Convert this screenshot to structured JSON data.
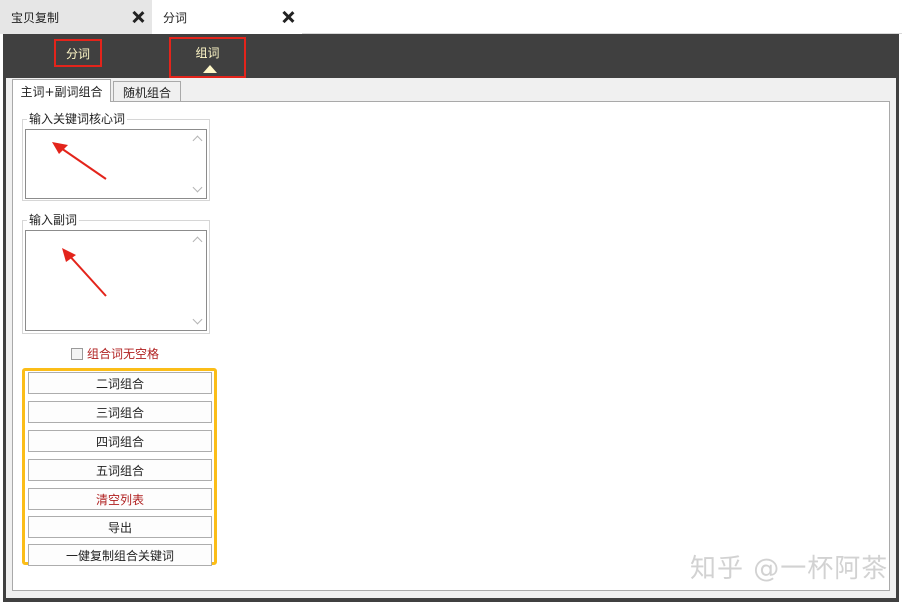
{
  "doc_tabs": [
    {
      "label": "宝贝复制"
    },
    {
      "label": "分词"
    }
  ],
  "modes": {
    "fenci": "分词",
    "zuci": "组词"
  },
  "inner_tabs": [
    {
      "label": "主词+副词组合"
    },
    {
      "label": "随机组合"
    }
  ],
  "core_group": {
    "legend": "输入关键词核心词",
    "value": ""
  },
  "sub_group": {
    "legend": "输入副词",
    "value": ""
  },
  "no_space_checkbox": {
    "label": "组合词无空格",
    "checked": false
  },
  "buttons": [
    {
      "label": "二词组合"
    },
    {
      "label": "三词组合"
    },
    {
      "label": "四词组合"
    },
    {
      "label": "五词组合"
    },
    {
      "label": "清空列表"
    },
    {
      "label": "导出"
    },
    {
      "label": "一健复制组合关键词"
    }
  ],
  "watermark": "知乎 @一杯阿茶",
  "colors": {
    "frame": "#404040",
    "highlight_red": "#e3241b",
    "highlight_yellow": "#fbbd18",
    "accent_text": "#b02020"
  }
}
